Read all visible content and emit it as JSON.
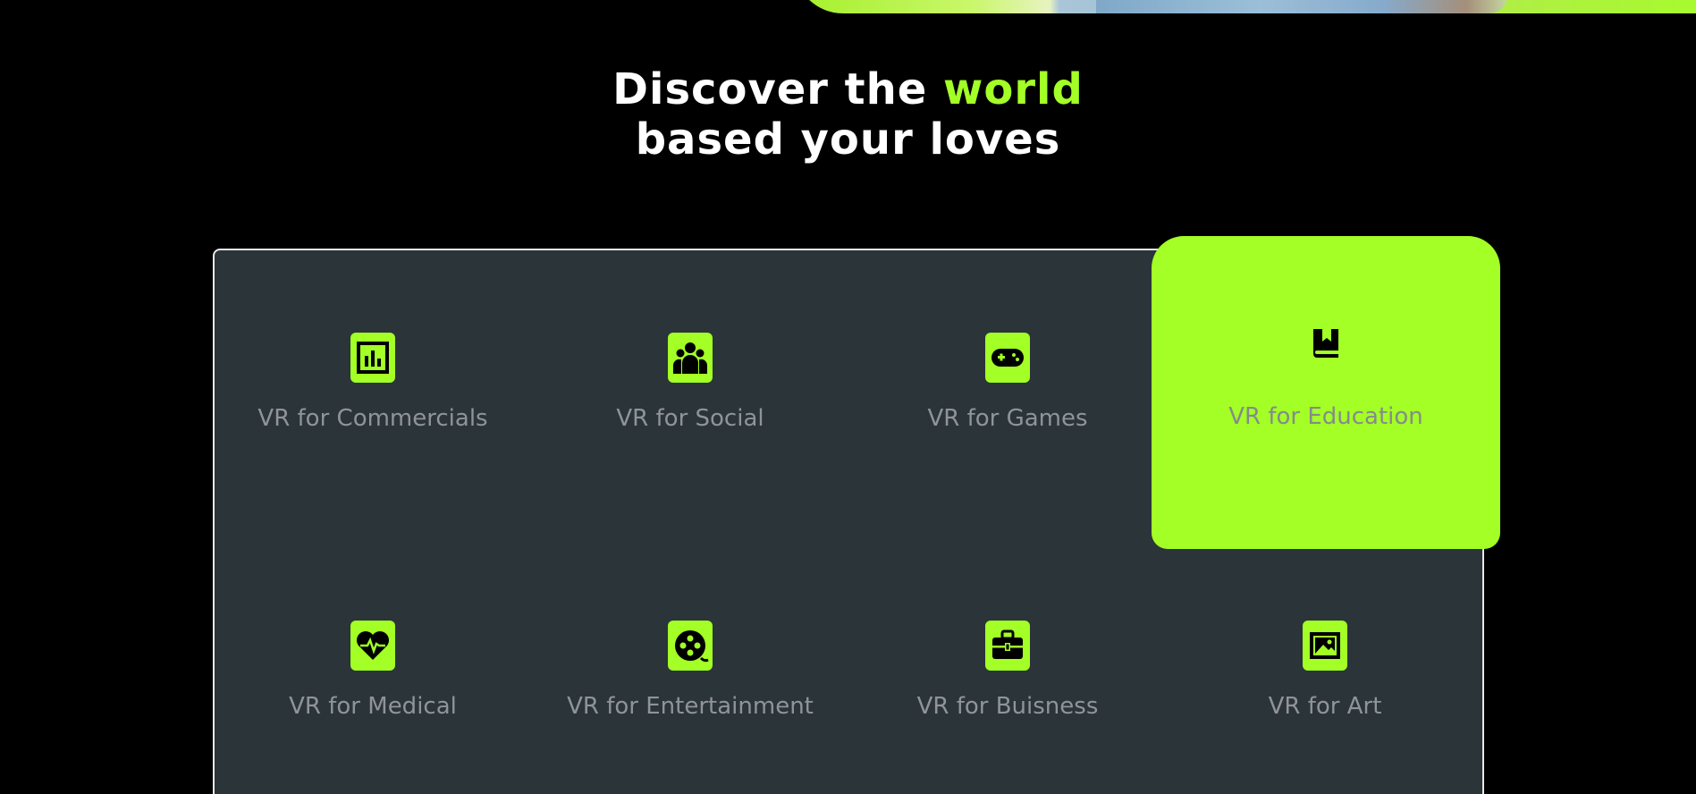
{
  "hero": {
    "title_part1": "Discover the ",
    "title_accent": "world",
    "title_line2": "based your loves"
  },
  "colors": {
    "accent": "#a3ff25",
    "panel": "#2b3439",
    "background": "#000000",
    "label": "#8f9499"
  },
  "categories": [
    {
      "label": "VR for Commercials",
      "icon": "bar-chart-icon",
      "active": false
    },
    {
      "label": "VR for Social",
      "icon": "people-icon",
      "active": false
    },
    {
      "label": "VR for Games",
      "icon": "gamepad-icon",
      "active": false
    },
    {
      "label": "VR for Education",
      "icon": "book-icon",
      "active": true
    },
    {
      "label": "VR for Medical",
      "icon": "heart-pulse-icon",
      "active": false
    },
    {
      "label": "VR for Entertainment",
      "icon": "film-reel-icon",
      "active": false
    },
    {
      "label": "VR for Buisness",
      "icon": "briefcase-icon",
      "active": false
    },
    {
      "label": "VR for Art",
      "icon": "image-icon",
      "active": false
    }
  ]
}
